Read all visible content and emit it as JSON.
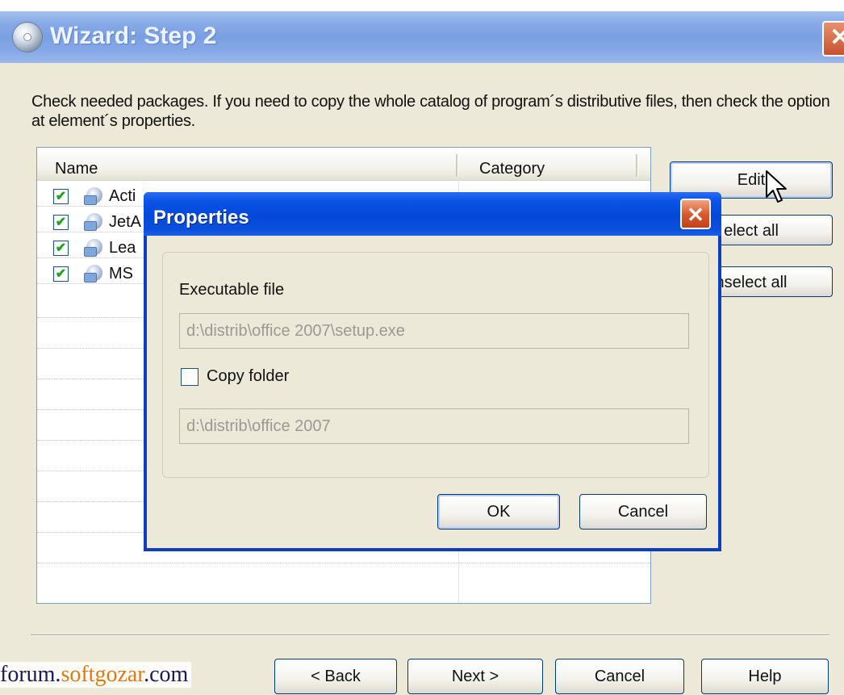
{
  "window": {
    "title": "Wizard: Step 2",
    "close_glyph": "✕"
  },
  "instructions": "Check needed packages. If you need to copy the whole catalog of program´s distributive files, then check the option at element´s properties.",
  "list": {
    "columns": [
      "Name",
      "Category"
    ],
    "rows": [
      {
        "name": "Acti",
        "checked": true
      },
      {
        "name": "JetA",
        "checked": true
      },
      {
        "name": "Lea",
        "checked": true
      },
      {
        "name": "MS",
        "checked": true
      }
    ],
    "check_glyph": "✔"
  },
  "side_buttons": {
    "edit": "Edit",
    "select_all": "elect all",
    "unselect_all": "nselect all"
  },
  "nav_buttons": {
    "back": "< Back",
    "next": "Next >",
    "cancel": "Cancel",
    "help": "Help"
  },
  "watermark": {
    "part1": "forum.",
    "part2": "softgozar",
    "part3": ".com"
  },
  "properties_dialog": {
    "title": "Properties",
    "close_glyph": "✕",
    "executable_label": "Executable file",
    "executable_value": "d:\\distrib\\office 2007\\setup.exe",
    "copy_folder_label": "Copy folder",
    "copy_folder_checked": false,
    "folder_value": "d:\\distrib\\office 2007",
    "ok": "OK",
    "cancel": "Cancel"
  },
  "colors": {
    "titlebar_inactive": "#86a9e6",
    "titlebar_active": "#0348d8",
    "close_red": "#d9552c",
    "dialog_face": "#ece9d8",
    "check_green": "#21a121"
  },
  "icons": [
    "wizard-disc-icon",
    "package-icon",
    "mouse-cursor-icon"
  ]
}
